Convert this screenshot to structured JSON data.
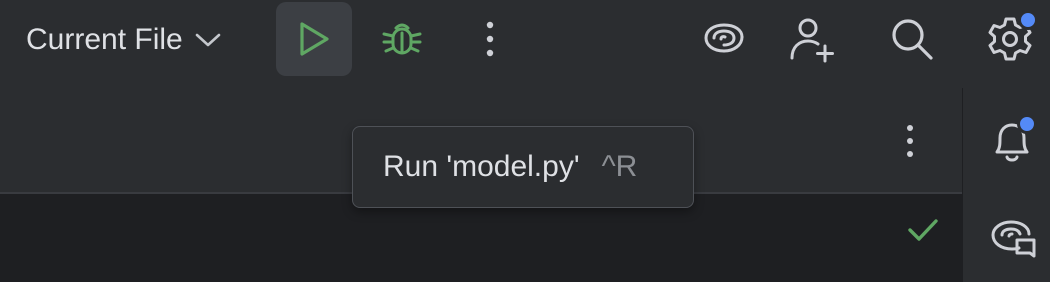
{
  "toolbar": {
    "run_config_label": "Current File",
    "icons": {
      "run": "play-icon",
      "debug": "bug-icon",
      "more": "more-vertical-icon",
      "ai": "ai-assistant-icon",
      "collab": "add-user-icon",
      "search": "search-icon",
      "settings": "gear-icon"
    }
  },
  "tooltip": {
    "text": "Run 'model.py'",
    "shortcut": "^R"
  },
  "right_strip": {
    "icons": [
      "bell-icon",
      "chat-icon"
    ]
  },
  "colors": {
    "accent_green": "#5fa763",
    "badge_blue": "#548af7",
    "toolbar_bg": "#2b2d30",
    "editor_bg": "#1e1f22"
  }
}
